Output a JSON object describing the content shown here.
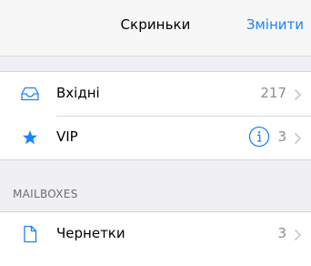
{
  "navbar": {
    "title": "Скриньки",
    "edit_label": "Змінити"
  },
  "groups": [
    {
      "rows": [
        {
          "label": "Вхідні",
          "count": "217",
          "icon": "inbox-tray-icon"
        },
        {
          "label": "VIP",
          "count": "3",
          "icon": "star-icon",
          "info_icon": "info-icon"
        }
      ]
    }
  ],
  "sections": {
    "mailboxes_header": "MAILBOXES"
  },
  "mailboxes": [
    {
      "label": "Чернетки",
      "count": "3",
      "icon": "document-icon"
    }
  ],
  "colors": {
    "accent": "#1a82fb",
    "background": "#efeff4",
    "secondary_text": "#8e8e93",
    "chevron": "#c7c7cc"
  }
}
